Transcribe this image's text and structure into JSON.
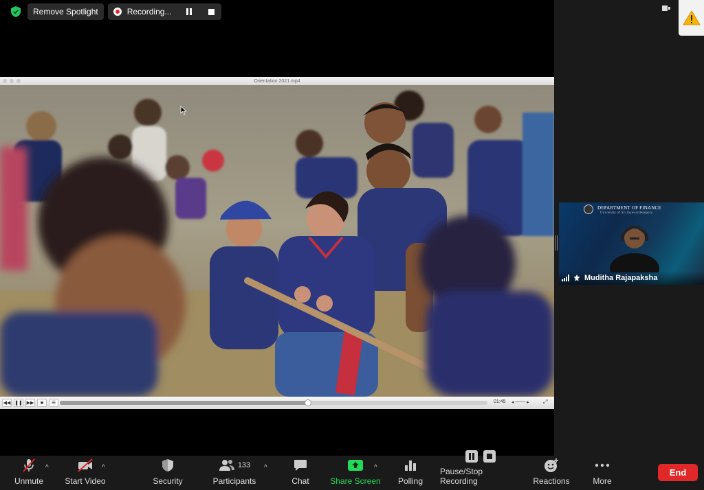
{
  "top": {
    "spotlight_button": "Remove Spotlight",
    "recording_label": "Recording..."
  },
  "video_window": {
    "file_name": "Orientation 2021.mp4",
    "current_time": "01:45",
    "progress": 0.58
  },
  "participant": {
    "name": "Muditha Rajapaksha",
    "background_text": "DEPARTMENT OF FINANCE",
    "background_subtext": "University of Sri Jayewardenepura"
  },
  "toolbar": {
    "unmute": "Unmute",
    "start_video": "Start Video",
    "security": "Security",
    "participants": "Participants",
    "participants_count": "133",
    "chat": "Chat",
    "share_screen": "Share Screen",
    "polling": "Polling",
    "pause_stop_recording": "Pause/Stop Recording",
    "reactions": "Reactions",
    "more": "More",
    "end": "End"
  },
  "colors": {
    "end_red": "#e02828",
    "share_green": "#23d959",
    "shield_green": "#22c55e",
    "toolbar_bg": "#1a1a1a"
  }
}
